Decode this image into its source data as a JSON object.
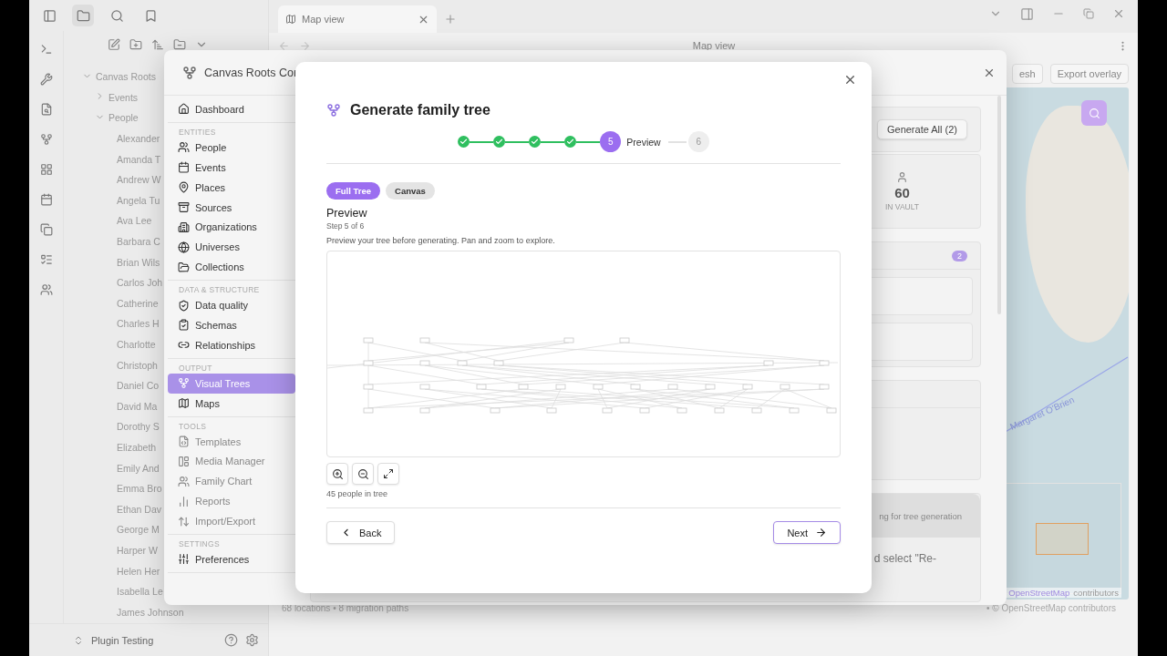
{
  "explorer": {
    "root": {
      "label": "Canvas Roots",
      "expanded": true,
      "children": [
        {
          "label": "Events",
          "expanded": false
        },
        {
          "label": "People",
          "expanded": true,
          "children": [
            "Alexander",
            "Amanda T",
            "Andrew W",
            "Angela Tu",
            "Ava Lee",
            "Barbara C",
            "Brian Wils",
            "Carlos Joh",
            "Catherine",
            "Charles H",
            "Charlotte",
            "Christoph",
            "Daniel Co",
            "David Ma",
            "Dorothy S",
            "Elizabeth",
            "Emily And",
            "Emma Bro",
            "Ethan Dav",
            "George M",
            "Harper W",
            "Helen Her",
            "Isabella Le",
            "James Johnson"
          ]
        }
      ]
    },
    "vault": "Plugin Testing"
  },
  "tab": {
    "title": "Map view"
  },
  "view_title": "Map view",
  "map": {
    "buttons": [
      "esh",
      "Export overlay"
    ],
    "path_label": "Margaret O'Brien",
    "attribution_link": "OpenStreetMap",
    "attribution_text": "contributors",
    "footer": "68 locations • 8 migration paths",
    "footer_attribution": "• © OpenStreetMap contributors"
  },
  "control_center": {
    "title": "Canvas Roots Cor",
    "nav": [
      {
        "items": [
          {
            "label": "Dashboard",
            "selected": false,
            "disabled": false
          }
        ]
      },
      {
        "heading": "ENTITIES",
        "items": [
          {
            "label": "People",
            "selected": false,
            "disabled": false
          },
          {
            "label": "Events",
            "selected": false,
            "disabled": false
          },
          {
            "label": "Places",
            "selected": false,
            "disabled": false
          },
          {
            "label": "Sources",
            "selected": false,
            "disabled": false
          },
          {
            "label": "Organizations",
            "selected": false,
            "disabled": false
          },
          {
            "label": "Universes",
            "selected": false,
            "disabled": false
          },
          {
            "label": "Collections",
            "selected": false,
            "disabled": false
          }
        ]
      },
      {
        "heading": "DATA & STRUCTURE",
        "items": [
          {
            "label": "Data quality",
            "selected": false,
            "disabled": false
          },
          {
            "label": "Schemas",
            "selected": false,
            "disabled": false
          },
          {
            "label": "Relationships",
            "selected": false,
            "disabled": false
          }
        ]
      },
      {
        "heading": "OUTPUT",
        "items": [
          {
            "label": "Visual Trees",
            "selected": true,
            "disabled": false
          },
          {
            "label": "Maps",
            "selected": false,
            "disabled": false
          }
        ]
      },
      {
        "heading": "TOOLS",
        "items": [
          {
            "label": "Templates",
            "selected": false,
            "disabled": true
          },
          {
            "label": "Media Manager",
            "selected": false,
            "disabled": true
          },
          {
            "label": "Family Chart",
            "selected": false,
            "disabled": true
          },
          {
            "label": "Reports",
            "selected": false,
            "disabled": true
          },
          {
            "label": "Import/Export",
            "selected": false,
            "disabled": true
          }
        ]
      },
      {
        "heading": "SETTINGS",
        "items": [
          {
            "label": "Preferences",
            "selected": false,
            "disabled": false
          }
        ]
      }
    ],
    "generate_all_button": "Generate All (2)",
    "stat": {
      "value": "60",
      "label": "IN VAULT"
    },
    "badge": "2",
    "notice_header": "ng for tree generation",
    "notice_text": "d select \"Re-"
  },
  "wizard": {
    "title": "Generate family tree",
    "steps": [
      {
        "kind": "done"
      },
      {
        "kind": "done"
      },
      {
        "kind": "done"
      },
      {
        "kind": "done"
      },
      {
        "label": "5",
        "kind": "current",
        "caption": "Preview"
      },
      {
        "label": "6",
        "kind": "pending"
      }
    ],
    "view_tabs": [
      {
        "label": "Full Tree",
        "selected": true
      },
      {
        "label": "Canvas",
        "selected": false
      }
    ],
    "section_title": "Preview",
    "step_text": "Step 5 of 6",
    "description": "Preview your tree before generating. Pan and zoom to explore.",
    "count": "45 people in tree",
    "back": "Back",
    "next": "Next"
  }
}
